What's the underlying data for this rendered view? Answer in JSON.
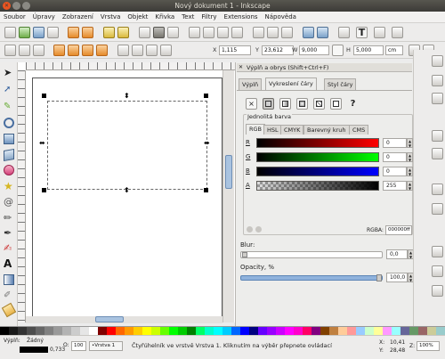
{
  "window": {
    "title": "Nový dokument 1 - Inkscape"
  },
  "menu": [
    "Soubor",
    "Úpravy",
    "Zobrazení",
    "Vrstva",
    "Objekt",
    "Křivka",
    "Text",
    "Filtry",
    "Extensions",
    "Nápověda"
  ],
  "coords": {
    "x_label": "X",
    "x_value": "1,115",
    "y_label": "Y",
    "y_value": "23,612",
    "w_label": "W",
    "w_value": "9,000",
    "h_label": "H",
    "h_value": "5,000",
    "unit": "cm"
  },
  "panel": {
    "title": "Výplň a obrys (Shift+Ctrl+F)",
    "tabs": [
      "Výplň",
      "Vykreslení čáry",
      "Styl čáry"
    ],
    "paint_buttons": [
      "×",
      "?"
    ],
    "flat_color_label": "Jednolitá barva",
    "color_modes": [
      "RGB",
      "HSL",
      "CMYK",
      "Barevný kruh",
      "CMS"
    ],
    "channels": [
      {
        "label": "R",
        "value": "0"
      },
      {
        "label": "G",
        "value": "0"
      },
      {
        "label": "B",
        "value": "0"
      },
      {
        "label": "A",
        "value": "255"
      }
    ],
    "rgba_label": "RGBA:",
    "rgba_value": "000000ff",
    "blur_label": "Blur:",
    "blur_value": "0,0",
    "opacity_label": "Opacity, %",
    "opacity_value": "100,0"
  },
  "status": {
    "fill_label": "Výplň:",
    "fill_value": "Žádný",
    "stroke_value": "0,733",
    "opacity_label": "O:",
    "opacity_value": "100",
    "layer": "•Vrstva 1",
    "message": "Čtyřúhelník ve vrstvě Vrstva 1. Kliknutím na výběr přepnete ovládací",
    "cursor_x_label": "X:",
    "cursor_x": "10,41",
    "cursor_y_label": "Y:",
    "cursor_y": "28,48",
    "zoom_label": "Z:",
    "zoom": "100%"
  },
  "palette_colors": [
    "#000000",
    "#1a1a1a",
    "#333333",
    "#4d4d4d",
    "#666666",
    "#808080",
    "#999999",
    "#b3b3b3",
    "#cccccc",
    "#e6e6e6",
    "#ffffff",
    "#800000",
    "#ff0000",
    "#ff6600",
    "#ff9900",
    "#ffcc00",
    "#ffff00",
    "#ccff00",
    "#66ff00",
    "#00ff00",
    "#00cc00",
    "#008000",
    "#00ff66",
    "#00ffcc",
    "#00ffff",
    "#00ccff",
    "#0066ff",
    "#0000ff",
    "#000080",
    "#6600ff",
    "#9900ff",
    "#cc00ff",
    "#ff00ff",
    "#ff00cc",
    "#ff0066",
    "#800080",
    "#804000",
    "#c08040",
    "#ffcc99",
    "#ff9999",
    "#99ccff",
    "#ccffcc",
    "#ffff99",
    "#ff99ff",
    "#99ffff",
    "#666699",
    "#669966",
    "#996666",
    "#cccc99",
    "#99cccc"
  ]
}
